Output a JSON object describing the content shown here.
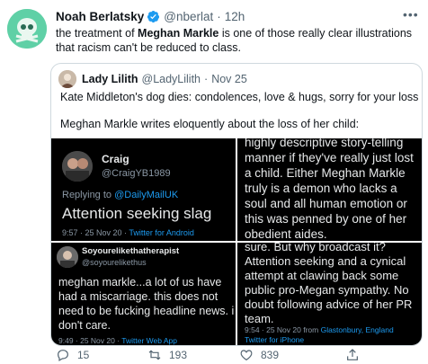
{
  "tweet": {
    "author_name": "Noah Berlatsky",
    "author_handle": "@nberlat",
    "separator": "·",
    "time": "12h",
    "text_pre": "the treatment of ",
    "text_bold": "Meghan Markle",
    "text_post": " is one of those really clear illustrations that racism can't be reduced to class."
  },
  "quote": {
    "author_name": "Lady Lilith",
    "author_handle": "@LadyLilith",
    "separator": "·",
    "time": "Nov 25",
    "line1": "Kate Middleton's dog dies: condolences, love & hugs, sorry for your loss",
    "line2": "Meghan Markle writes eloquently  about the loss of her child:"
  },
  "images": {
    "c1": {
      "name": "Craig",
      "handle": "@CraigYB1989",
      "replying_prefix": "Replying to ",
      "replying_to": "@DailyMailUK",
      "text": "Attention seeking slag",
      "meta_time": "9:57 · 25 Nov 20 · ",
      "meta_source": "Twitter for Android"
    },
    "c2": {
      "text": "highly descriptive story-telling manner if they've really just lost a child. Either Meghan Markle truly is a demon who lacks a soul and all human emotion or this was penned by one of her obedient aides."
    },
    "c3": {
      "name": "Soyourelikethatherapist",
      "handle": "@soyourelikethus",
      "text": "meghan markle...a lot of us have had a miscarriage. this does not need to be fucking headline news. i don't care.",
      "meta_time": "9:49 · 25 Nov 20 · ",
      "meta_source": "Twitter Web App"
    },
    "c4": {
      "text": "sure. But why broadcast it? Attention seeking and a cynical attempt at clawing back some public pro-Megan sympathy. No doubt following advice of her PR team.",
      "meta_time": "9:54 · 25 Nov 20 from ",
      "meta_place": "Glastonbury, England",
      "meta_source": "Twitter for iPhone"
    }
  },
  "actions": {
    "reply_count": "15",
    "retweet_count": "193",
    "like_count": "839"
  },
  "colors": {
    "accent": "#1d9bf0",
    "text": "#0f1419",
    "secondary": "#536471",
    "border": "#cfd9de"
  },
  "icons": [
    "verified-badge-icon",
    "more-icon",
    "reply-icon",
    "retweet-icon",
    "like-icon",
    "share-icon"
  ]
}
